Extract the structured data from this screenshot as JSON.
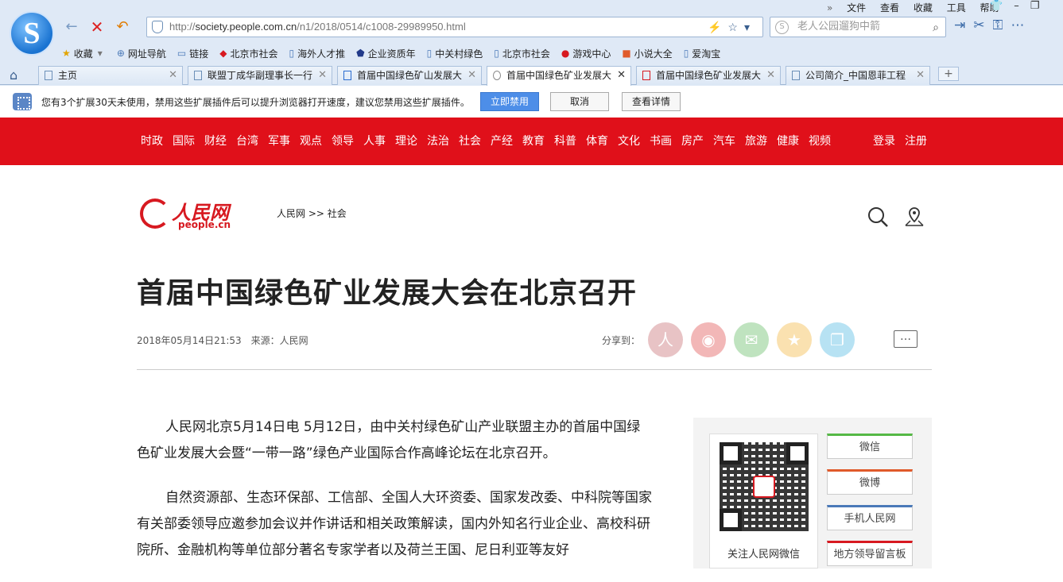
{
  "browser": {
    "url_prefix": "http://",
    "url_host": "society.people.com.cn",
    "url_path": "/n1/2018/0514/c1008-29989950.html",
    "search_placeholder": "老人公园遛狗中箭",
    "menu": [
      "文件",
      "查看",
      "收藏",
      "工具",
      "帮助"
    ],
    "bookmarks": [
      "收藏",
      "网址导航",
      "链接",
      "北京市社会",
      "海外人才推",
      "企业资质年",
      "中关村绿色",
      "北京市社会",
      "游戏中心",
      "小说大全",
      "爱淘宝"
    ],
    "tabs": [
      {
        "label": "主页"
      },
      {
        "label": "联盟丁成华副理事长一行"
      },
      {
        "label": "首届中国绿色矿山发展大"
      },
      {
        "label": "首届中国绿色矿业发展大"
      },
      {
        "label": "首届中国绿色矿业发展大"
      },
      {
        "label": "公司简介_中国恩菲工程"
      }
    ],
    "ext_message": "您有3个扩展30天未使用，禁用这些扩展插件后可以提升浏览器打开速度，建议您禁用这些扩展插件。",
    "ext_buttons": {
      "disable": "立即禁用",
      "cancel": "取消",
      "details": "查看详情"
    }
  },
  "site": {
    "nav": [
      "时政",
      "国际",
      "财经",
      "台湾",
      "军事",
      "观点",
      "领导",
      "人事",
      "理论",
      "法治",
      "社会",
      "产经",
      "教育",
      "科普",
      "体育",
      "文化",
      "书画",
      "房产",
      "汽车",
      "旅游",
      "健康",
      "视频"
    ],
    "login": "登录",
    "register": "注册",
    "logo_cn": "人民网",
    "logo_en": "people.cn",
    "breadcrumb": "人民网 >> 社会"
  },
  "article": {
    "title": "首届中国绿色矿业发展大会在北京召开",
    "date": "2018年05月14日21:53",
    "source": "来源：人民网",
    "share_label": "分享到：",
    "paragraphs": [
      "人民网北京5月14日电 5月12日，由中关村绿色矿山产业联盟主办的首届中国绿色矿业发展大会暨“一带一路”绿色产业国际合作高峰论坛在北京召开。",
      "自然资源部、生态环保部、工信部、全国人大环资委、国家发改委、中科院等国家有关部委领导应邀参加会议并作讲话和相关政策解读，国内外知名行业企业、高校科研院所、金融机构等单位部分著名专家学者以及荷兰王国、尼日利亚等友好"
    ]
  },
  "sidebar": {
    "qr_caption": "关注人民网微信",
    "buttons": [
      "微信",
      "微博",
      "手机人民网",
      "地方领导留言板"
    ]
  },
  "colors": {
    "brand_red": "#e0101a"
  }
}
